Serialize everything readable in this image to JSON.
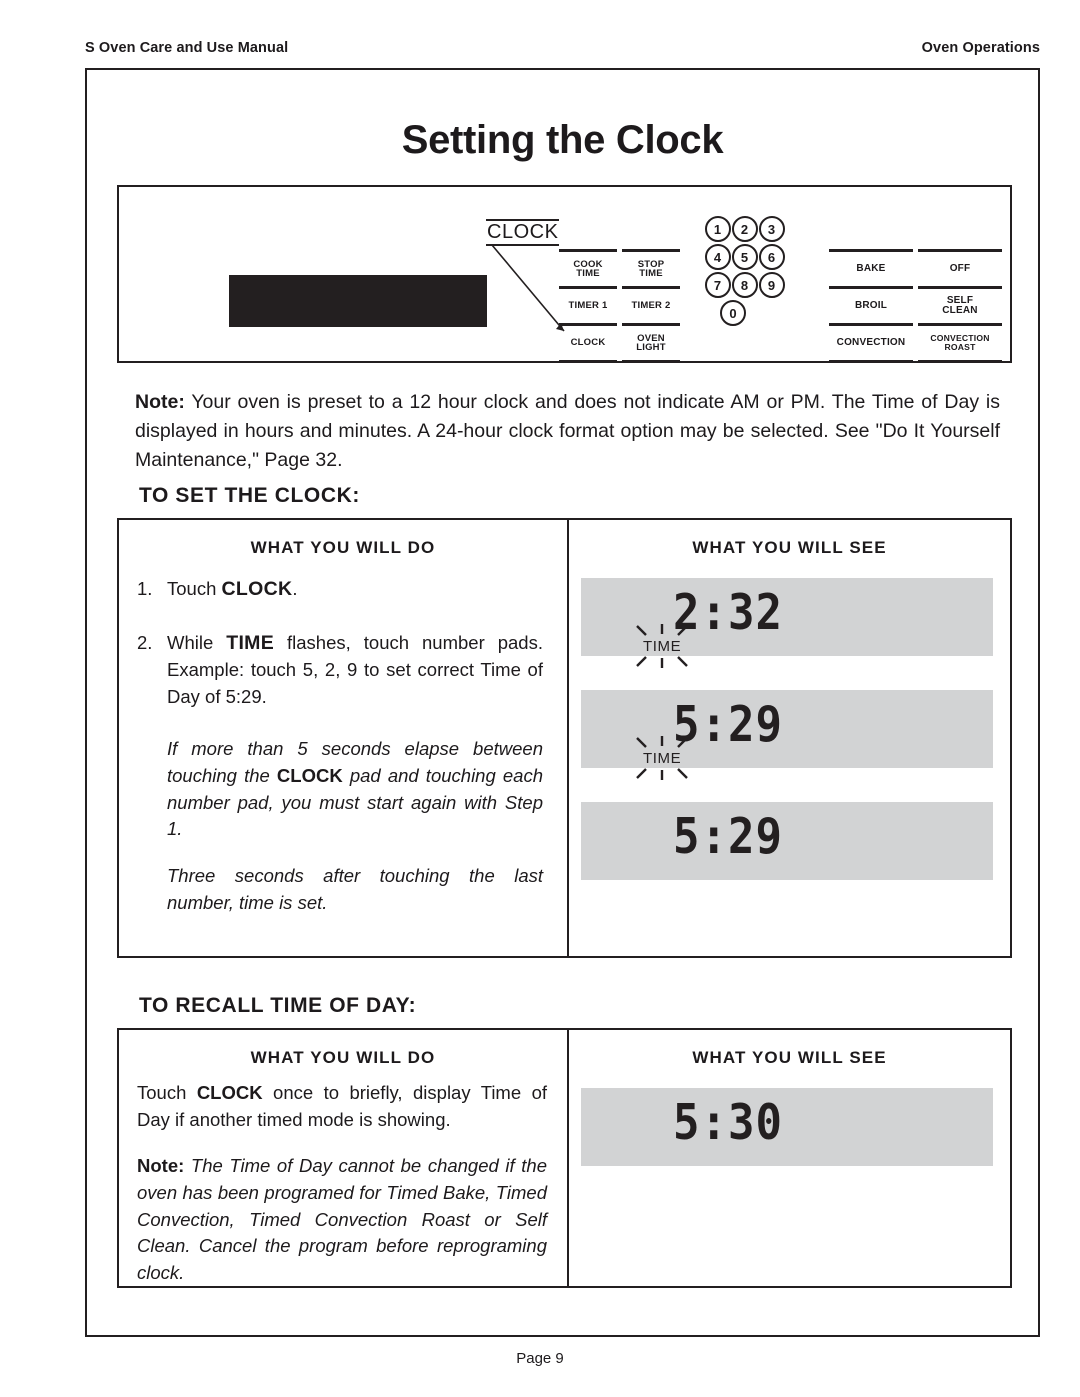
{
  "header": {
    "left": "S Oven Care and Use Manual",
    "right": "Oven Operations"
  },
  "title": "Setting the Clock",
  "control_panel": {
    "callout_label": "CLOCK",
    "left_keys": [
      [
        "COOK TIME",
        "STOP TIME"
      ],
      [
        "TIMER 1",
        "TIMER 2"
      ],
      [
        "CLOCK",
        "OVEN LIGHT"
      ]
    ],
    "left_keys_flat": {
      "cook_time_line1": "COOK",
      "cook_time_line2": "TIME",
      "stop_time_line1": "STOP",
      "stop_time_line2": "TIME",
      "timer1": "TIMER 1",
      "timer2": "TIMER 2",
      "clock": "CLOCK",
      "oven_light_line1": "OVEN",
      "oven_light_line2": "LIGHT"
    },
    "number_pads": [
      "1",
      "2",
      "3",
      "4",
      "5",
      "6",
      "7",
      "8",
      "9",
      "0"
    ],
    "mode_keys": {
      "bake": "BAKE",
      "off": "OFF",
      "broil": "BROIL",
      "self_clean_line1": "SELF",
      "self_clean_line2": "CLEAN",
      "convection": "CONVECTION",
      "convection_roast_line1": "CONVECTION",
      "convection_roast_line2": "ROAST"
    }
  },
  "note_top": {
    "label": "Note:",
    "text": "Your oven is preset to a 12 hour clock and does not indicate AM or PM.  The Time of Day is displayed in hours and minutes. A 24-hour clock format option may be selected. See \"Do It Yourself Maintenance,\" Page 32."
  },
  "set_clock": {
    "heading": "TO SET THE CLOCK:",
    "col_do_title": "WHAT YOU WILL DO",
    "col_see_title": "WHAT YOU WILL SEE",
    "step1": {
      "num": "1.",
      "pre": "Touch ",
      "bold": "CLOCK",
      "post": "."
    },
    "step2": {
      "num": "2.",
      "pre": "While ",
      "bold": "TIME",
      "post": " flashes, touch number pads. Example: touch 5, 2, 9 to set correct Time of Day of 5:29."
    },
    "italic_note_1": {
      "pre": "If more than 5 seconds elapse between touching the ",
      "bold": "CLOCK",
      "post": " pad and touching each number pad, you must start again with Step 1."
    },
    "italic_note_2": "Three seconds after touching the last number, time is set.",
    "displays": [
      {
        "time": "2:32",
        "indicator": "TIME",
        "flashing": true
      },
      {
        "time": "5:29",
        "indicator": "TIME",
        "flashing": true
      },
      {
        "time": "5:29",
        "indicator": "",
        "flashing": false
      }
    ]
  },
  "recall_time": {
    "heading": "TO RECALL TIME OF DAY:",
    "col_do_title": "WHAT YOU WILL DO",
    "col_see_title": "WHAT YOU WILL SEE",
    "body": {
      "pre": "Touch ",
      "bold": "CLOCK",
      "post": " once to briefly, display Time of Day if another timed mode is showing."
    },
    "note": {
      "label": "Note:",
      "text": "The Time of Day cannot be changed if the oven has been programed for Timed Bake, Timed Convection, Timed Convection Roast or Self Clean. Cancel the program before reprograming clock."
    },
    "display": {
      "time": "5:30",
      "indicator": "",
      "flashing": false
    }
  },
  "footer": "Page 9",
  "colors": {
    "ink": "#231f20",
    "lcd_panel": "#d2d3d4",
    "lcd_dark": "#231f20"
  }
}
